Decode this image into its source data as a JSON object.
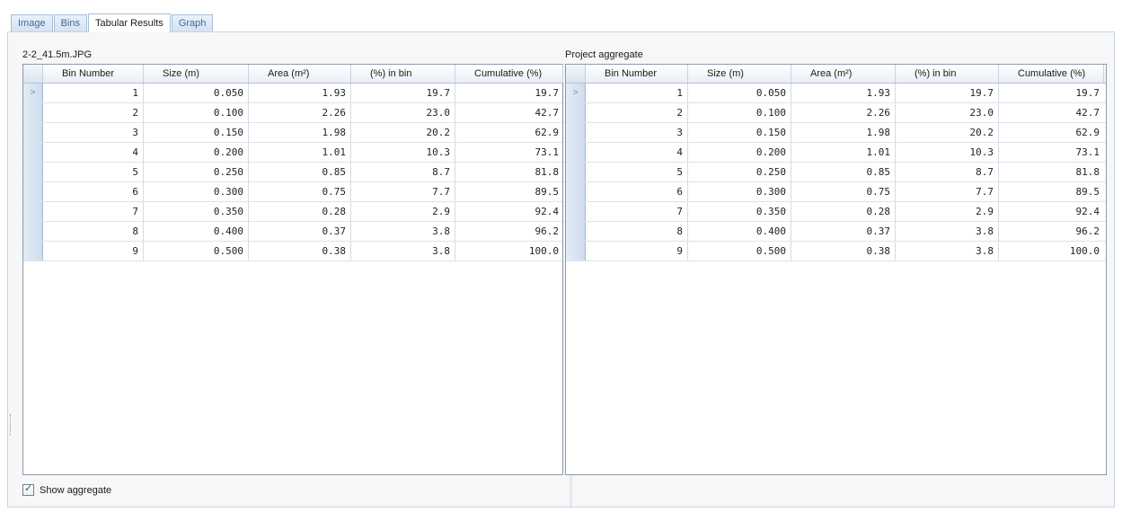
{
  "tabs": [
    {
      "label": "Image"
    },
    {
      "label": "Bins"
    },
    {
      "label": "Tabular Results"
    },
    {
      "label": "Graph"
    }
  ],
  "left_table": {
    "title": "2-2_41.5m.JPG",
    "headers": [
      "Bin Number",
      "Size (m)",
      "Area (m²)",
      "(%) in bin",
      "Cumulative (%)"
    ],
    "rows": [
      [
        "1",
        "0.050",
        "1.93",
        "19.7",
        "19.7"
      ],
      [
        "2",
        "0.100",
        "2.26",
        "23.0",
        "42.7"
      ],
      [
        "3",
        "0.150",
        "1.98",
        "20.2",
        "62.9"
      ],
      [
        "4",
        "0.200",
        "1.01",
        "10.3",
        "73.1"
      ],
      [
        "5",
        "0.250",
        "0.85",
        "8.7",
        "81.8"
      ],
      [
        "6",
        "0.300",
        "0.75",
        "7.7",
        "89.5"
      ],
      [
        "7",
        "0.350",
        "0.28",
        "2.9",
        "92.4"
      ],
      [
        "8",
        "0.400",
        "0.37",
        "3.8",
        "96.2"
      ],
      [
        "9",
        "0.500",
        "0.38",
        "3.8",
        "100.0"
      ]
    ],
    "current_row_marker": ">"
  },
  "right_table": {
    "title": "Project aggregate",
    "headers": [
      "Bin Number",
      "Size (m)",
      "Area (m²)",
      "(%) in bin",
      "Cumulative (%)"
    ],
    "rows": [
      [
        "1",
        "0.050",
        "1.93",
        "19.7",
        "19.7"
      ],
      [
        "2",
        "0.100",
        "2.26",
        "23.0",
        "42.7"
      ],
      [
        "3",
        "0.150",
        "1.98",
        "20.2",
        "62.9"
      ],
      [
        "4",
        "0.200",
        "1.01",
        "10.3",
        "73.1"
      ],
      [
        "5",
        "0.250",
        "0.85",
        "8.7",
        "81.8"
      ],
      [
        "6",
        "0.300",
        "0.75",
        "7.7",
        "89.5"
      ],
      [
        "7",
        "0.350",
        "0.28",
        "2.9",
        "92.4"
      ],
      [
        "8",
        "0.400",
        "0.37",
        "3.8",
        "96.2"
      ],
      [
        "9",
        "0.500",
        "0.38",
        "3.8",
        "100.0"
      ]
    ],
    "current_row_marker": ">"
  },
  "show_aggregate": {
    "label": "Show aggregate",
    "checked": true,
    "check_glyph": "✓"
  },
  "colors": {
    "tab_text": "#3d6a99",
    "grid_border": "#8b99ab",
    "row_selector": "#cfdced"
  }
}
